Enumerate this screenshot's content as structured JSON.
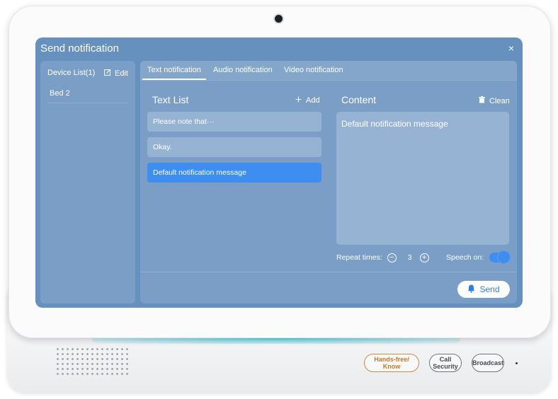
{
  "dialog": {
    "title": "Send notification",
    "close_label": "×"
  },
  "device_list": {
    "title": "Device List(1)",
    "edit_label": "Edit",
    "items": [
      {
        "label": "Bed 2"
      }
    ]
  },
  "tabs": [
    {
      "label": "Text notification",
      "active": true
    },
    {
      "label": "Audio notification",
      "active": false
    },
    {
      "label": "Video notification",
      "active": false
    }
  ],
  "text_list": {
    "title": "Text List",
    "add_label": "Add",
    "items": [
      {
        "label": "Please note that···"
      },
      {
        "label": "Okay."
      },
      {
        "label": "Default notification message",
        "selected": true
      }
    ]
  },
  "content": {
    "title": "Content",
    "clean_label": "Clean",
    "value": "Default notification message",
    "repeat_label": "Repeat times:",
    "repeat_value": "3",
    "minus_glyph": "−",
    "plus_glyph": "+",
    "speech_label": "Speech on:",
    "speech_on": true
  },
  "send_label": "Send",
  "hardware": {
    "hands_free": "Hands-free/\nKnow",
    "call_security": "Call\nSecurity",
    "broadcast": "Broadcast"
  },
  "colors": {
    "screen_bg": "#6690bd",
    "panel_bg": "#7b9ec6",
    "selected": "#3d8ef0",
    "accent_orange": "#d08a3c"
  },
  "icons": {
    "edit": "edit-icon",
    "add": "plus-icon",
    "clean": "trash-icon",
    "send": "bell-icon",
    "close": "close-icon"
  }
}
